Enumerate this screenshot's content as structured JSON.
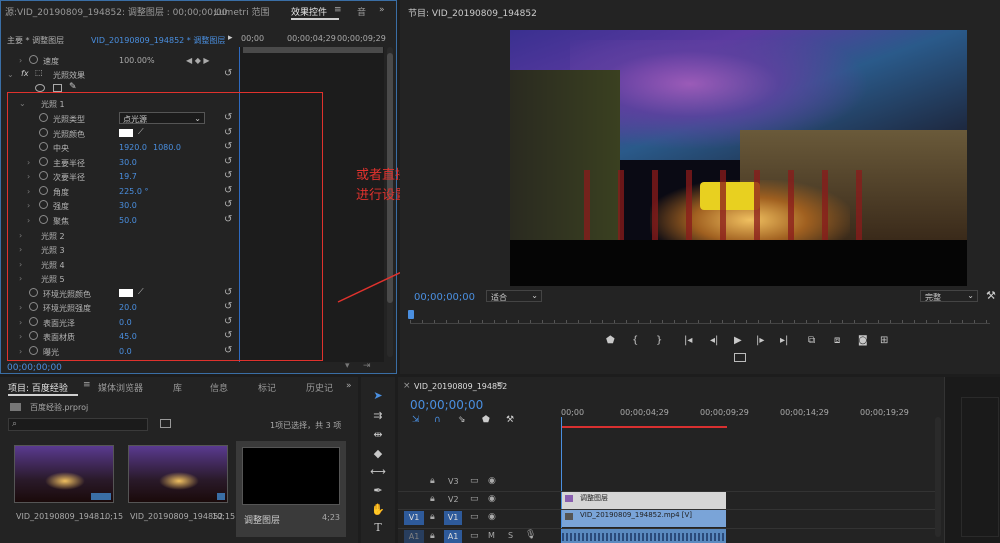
{
  "source_panel": {
    "tabs": [
      "源:VID_20190809_194852: 调整图层 : 00;00;00;00",
      "Lumetri 范围",
      "效果控件",
      "音"
    ],
    "master_label": "主要 * 调整图层",
    "sequence_label": "VID_20190809_194852 * 调整图层",
    "ruler_times": [
      "00;00",
      "00;00;04;29",
      "00;00;09;29"
    ],
    "speed_label": "速度",
    "speed_value": "100.00%",
    "effect_name": "光照效果",
    "light1": "光照 1",
    "light_type_label": "光照类型",
    "light_type_value": "点光源",
    "light_color_label": "光照颜色",
    "center_label": "中央",
    "center_x": "1920.0",
    "center_y": "1080.0",
    "major_radius_label": "主要半径",
    "major_radius_value": "30.0",
    "minor_radius_label": "次要半径",
    "minor_radius_value": "19.7",
    "angle_label": "角度",
    "angle_value": "225.0 °",
    "intensity_label": "强度",
    "intensity_value": "30.0",
    "focus_label": "聚焦",
    "focus_value": "50.0",
    "light2": "光照 2",
    "light3": "光照 3",
    "light4": "光照 4",
    "light5": "光照 5",
    "ambient_color_label": "环境光照颜色",
    "ambient_intensity_label": "环境光照强度",
    "ambient_intensity_value": "20.0",
    "surface_gloss_label": "表面光泽",
    "surface_gloss_value": "0.0",
    "surface_material_label": "表面材质",
    "surface_material_value": "45.0",
    "exposure_label": "曝光",
    "exposure_value": "0.0",
    "timecode": "00;00;00;00"
  },
  "annotation": {
    "line1": "或者直接通过参数来",
    "line2": "进行设置",
    "color": "#e0322d"
  },
  "program_panel": {
    "title": "节目: VID_20190809_194852",
    "timecode": "00;00;00;00",
    "zoom": "适合",
    "quality": "完整"
  },
  "project_panel": {
    "tabs": [
      "项目: 百度经验",
      "媒体浏览器",
      "库",
      "信息",
      "标记",
      "历史记"
    ],
    "file": "百度经验.prproj",
    "selection_info": "1项已选择，共 3 项",
    "items": [
      {
        "name": "VID_20190809_1948...",
        "duration": "10;15"
      },
      {
        "name": "VID_20190809_194852",
        "duration": "10;15"
      },
      {
        "name": "调整图层",
        "duration": "4;23"
      }
    ]
  },
  "timeline": {
    "title": "VID_20190809_194852",
    "timecode": "00;00;00;00",
    "ruler": [
      "00;00",
      "00;00;04;29",
      "00;00;09;29",
      "00;00;14;29",
      "00;00;19;29"
    ],
    "tracks": [
      "V3",
      "V2",
      "V1",
      "A1"
    ],
    "v1_source": "V1",
    "a1_source": "A1",
    "clip_adjust": "调整图层",
    "clip_video": "VID_20190809_194852.mp4 [V]",
    "mute": "M",
    "solo": "S"
  }
}
